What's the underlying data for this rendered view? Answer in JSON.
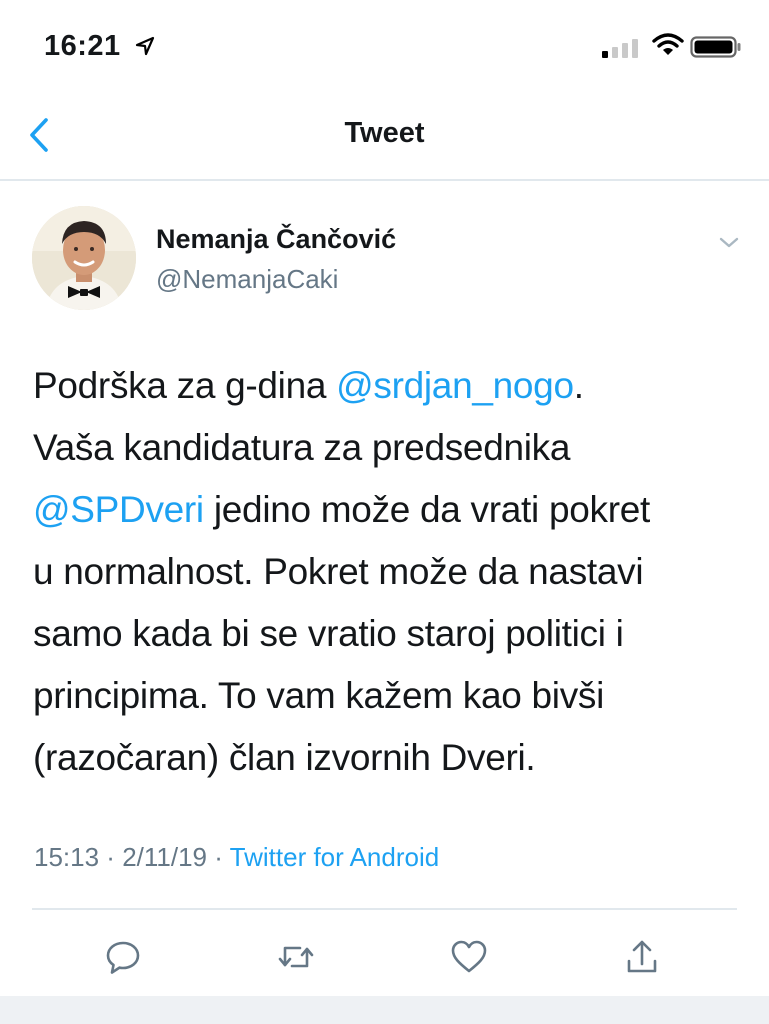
{
  "status_bar": {
    "time": "16:21",
    "icons": [
      "location-arrow-icon",
      "signal-icon",
      "wifi-icon",
      "battery-icon"
    ]
  },
  "nav": {
    "title": "Tweet",
    "back_icon": "chevron-left-icon"
  },
  "tweet": {
    "author": {
      "name": "Nemanja Čančović",
      "handle": "@NemanjaCaki"
    },
    "text_lines": [
      [
        {
          "t": "Podrška za g-dina "
        },
        {
          "t": "@srdjan_nogo",
          "mention": true
        },
        {
          "t": "."
        }
      ],
      [
        {
          "t": "Vaša kandidatura za predsednika"
        }
      ],
      [
        {
          "t": "@SPDveri",
          "mention": true
        },
        {
          "t": " jedino može da vrati pokret"
        }
      ],
      [
        {
          "t": "u normalnost. Pokret može da nastavi"
        }
      ],
      [
        {
          "t": "samo kada bi se vratio staroj politici i"
        }
      ],
      [
        {
          "t": "principima. To vam kažem kao bivši"
        }
      ],
      [
        {
          "t": "(razočaran) član izvornih Dveri."
        }
      ]
    ],
    "time": "15:13",
    "separator": " · ",
    "date": "2/11/19",
    "source": "Twitter for Android"
  },
  "actions": [
    "reply-icon",
    "retweet-icon",
    "like-icon",
    "share-icon"
  ],
  "colors": {
    "accent": "#1da1f2",
    "text": "#14171a",
    "secondary": "#657786",
    "divider": "#e1e8ed"
  }
}
